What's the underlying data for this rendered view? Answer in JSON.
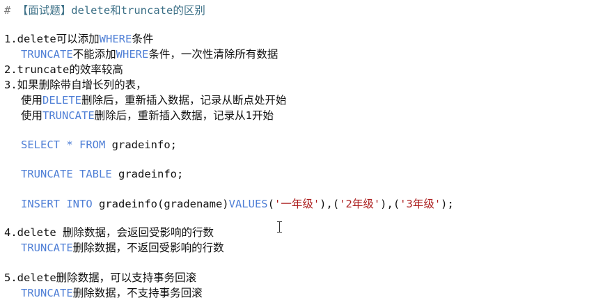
{
  "editor": {
    "comment_mark": "#",
    "title_text": "【面试题】delete和truncate的区别",
    "p1": {
      "a": "1.delete可以添加",
      "kw": "WHERE",
      "b": "条件"
    },
    "p1b": {
      "kw1": "TRUNCATE",
      "a": "不能添加",
      "kw2": "WHERE",
      "b": "条件，一次性清除所有数据"
    },
    "p2": "2.truncate的效率较高",
    "p3": "3.如果删除带自增长列的表，",
    "p3a": {
      "a": "使用",
      "kw": "DELETE",
      "b": "删除后，重新插入数据，记录从断点处开始"
    },
    "p3b": {
      "a": "使用",
      "kw": "TRUNCATE",
      "b": "删除后，重新插入数据，记录从1开始"
    },
    "sql_select": {
      "kw1": "SELECT",
      "star": " * ",
      "kw2": "FROM",
      "rest": " gradeinfo;"
    },
    "sql_truncate": {
      "kw1": "TRUNCATE",
      "sp": " ",
      "kw2": "TABLE",
      "rest": " gradeinfo;"
    },
    "sql_insert": {
      "kw1": "INSERT",
      "sp": " ",
      "kw2": "INTO",
      "rest": " gradeinfo(gradename)",
      "kw3": "VALUES",
      "p_open1": "(",
      "s1": "'一年级'",
      "sep1": "),(",
      "s2": "'2年级'",
      "sep2": "),(",
      "s3": "'3年级'",
      "end": ");"
    },
    "p4": "4.delete 删除数据，会返回受影响的行数",
    "p4b": {
      "kw": "TRUNCATE",
      "a": "删除数据，不返回受影响的行数"
    },
    "p5": "5.delete删除数据，可以支持事务回滚",
    "p5b": {
      "kw": "TRUNCATE",
      "a": "删除数据，不支持事务回滚"
    }
  }
}
